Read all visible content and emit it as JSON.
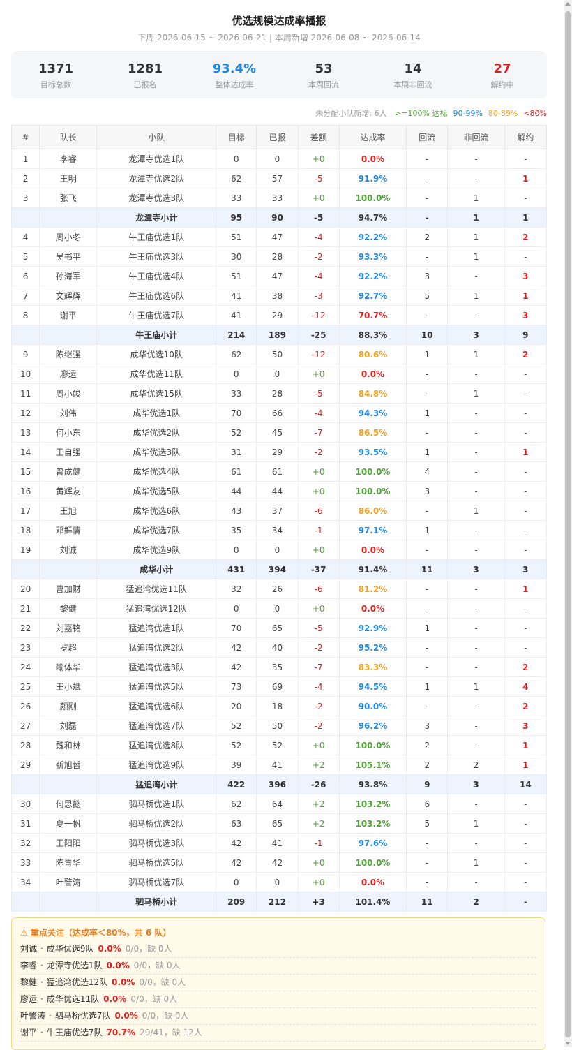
{
  "header": {
    "title": "优选规模达成率播报",
    "subtitle": "下周 2026-06-15 ~ 2026-06-21 | 本周新增 2026-06-08 ~ 2026-06-14"
  },
  "stats": [
    {
      "value": "1371",
      "label": "目标总数",
      "color": "#333333"
    },
    {
      "value": "1281",
      "label": "已报名",
      "color": "#333333"
    },
    {
      "value": "93.4%",
      "label": "整体达成率",
      "color": "#1e88e5"
    },
    {
      "value": "53",
      "label": "本周回流",
      "color": "#333333"
    },
    {
      "value": "14",
      "label": "本周非回流",
      "color": "#333333"
    },
    {
      "value": "27",
      "label": "解约中",
      "color": "#e02020"
    }
  ],
  "legend": {
    "unassigned": "未分配小队新增: 6人",
    "items": [
      {
        "text": ">=100% 达标",
        "color": "#52a33a"
      },
      {
        "text": "90-99%",
        "color": "#1e88e5"
      },
      {
        "text": "80-89%",
        "color": "#f0a020"
      },
      {
        "text": "<80%",
        "color": "#e02020"
      }
    ]
  },
  "table": {
    "columns": [
      "#",
      "队长",
      "小队",
      "目标",
      "已报",
      "差额",
      "达成率",
      "回流",
      "非回流",
      "解约"
    ],
    "rows": [
      {
        "type": "row",
        "idx": "1",
        "leader": "李睿",
        "team": "龙潭寺优选1队",
        "target": "0",
        "signed": "0",
        "diff": "+0",
        "rate": "0.0%",
        "back": "-",
        "nonback": "-",
        "jy": "-"
      },
      {
        "type": "row",
        "idx": "2",
        "leader": "王明",
        "team": "龙潭寺优选2队",
        "target": "62",
        "signed": "57",
        "diff": "-5",
        "rate": "91.9%",
        "back": "-",
        "nonback": "-",
        "jy": "1"
      },
      {
        "type": "row",
        "idx": "3",
        "leader": "张飞",
        "team": "龙潭寺优选3队",
        "target": "33",
        "signed": "33",
        "diff": "+0",
        "rate": "100.0%",
        "back": "-",
        "nonback": "1",
        "jy": "-"
      },
      {
        "type": "sub",
        "team": "龙潭寺小计",
        "target": "95",
        "signed": "90",
        "diff": "-5",
        "rate": "94.7%",
        "back": "-",
        "nonback": "1",
        "jy": "1"
      },
      {
        "type": "row",
        "idx": "4",
        "leader": "周小冬",
        "team": "牛王庙优选1队",
        "target": "51",
        "signed": "47",
        "diff": "-4",
        "rate": "92.2%",
        "back": "2",
        "nonback": "1",
        "jy": "2"
      },
      {
        "type": "row",
        "idx": "5",
        "leader": "吴书平",
        "team": "牛王庙优选3队",
        "target": "30",
        "signed": "28",
        "diff": "-2",
        "rate": "93.3%",
        "back": "-",
        "nonback": "1",
        "jy": "-"
      },
      {
        "type": "row",
        "idx": "6",
        "leader": "孙海军",
        "team": "牛王庙优选4队",
        "target": "51",
        "signed": "47",
        "diff": "-4",
        "rate": "92.2%",
        "back": "3",
        "nonback": "-",
        "jy": "3"
      },
      {
        "type": "row",
        "idx": "7",
        "leader": "文辉辉",
        "team": "牛王庙优选6队",
        "target": "41",
        "signed": "38",
        "diff": "-3",
        "rate": "92.7%",
        "back": "5",
        "nonback": "1",
        "jy": "1"
      },
      {
        "type": "row",
        "idx": "8",
        "leader": "谢平",
        "team": "牛王庙优选7队",
        "target": "41",
        "signed": "29",
        "diff": "-12",
        "rate": "70.7%",
        "back": "-",
        "nonback": "-",
        "jy": "3"
      },
      {
        "type": "sub",
        "team": "牛王庙小计",
        "target": "214",
        "signed": "189",
        "diff": "-25",
        "rate": "88.3%",
        "back": "10",
        "nonback": "3",
        "jy": "9"
      },
      {
        "type": "row",
        "idx": "9",
        "leader": "陈继强",
        "team": "成华优选10队",
        "target": "62",
        "signed": "50",
        "diff": "-12",
        "rate": "80.6%",
        "back": "1",
        "nonback": "1",
        "jy": "2"
      },
      {
        "type": "row",
        "idx": "10",
        "leader": "廖运",
        "team": "成华优选11队",
        "target": "0",
        "signed": "0",
        "diff": "+0",
        "rate": "0.0%",
        "back": "-",
        "nonback": "-",
        "jy": "-"
      },
      {
        "type": "row",
        "idx": "11",
        "leader": "周小竣",
        "team": "成华优选15队",
        "target": "33",
        "signed": "28",
        "diff": "-5",
        "rate": "84.8%",
        "back": "-",
        "nonback": "1",
        "jy": "-"
      },
      {
        "type": "row",
        "idx": "12",
        "leader": "刘伟",
        "team": "成华优选1队",
        "target": "70",
        "signed": "66",
        "diff": "-4",
        "rate": "94.3%",
        "back": "1",
        "nonback": "-",
        "jy": "-"
      },
      {
        "type": "row",
        "idx": "13",
        "leader": "何小东",
        "team": "成华优选2队",
        "target": "52",
        "signed": "45",
        "diff": "-7",
        "rate": "86.5%",
        "back": "-",
        "nonback": "-",
        "jy": "-"
      },
      {
        "type": "row",
        "idx": "14",
        "leader": "王自强",
        "team": "成华优选3队",
        "target": "31",
        "signed": "29",
        "diff": "-2",
        "rate": "93.5%",
        "back": "1",
        "nonback": "-",
        "jy": "1"
      },
      {
        "type": "row",
        "idx": "15",
        "leader": "曾成健",
        "team": "成华优选4队",
        "target": "61",
        "signed": "61",
        "diff": "+0",
        "rate": "100.0%",
        "back": "4",
        "nonback": "-",
        "jy": "-"
      },
      {
        "type": "row",
        "idx": "16",
        "leader": "黄辉友",
        "team": "成华优选5队",
        "target": "44",
        "signed": "44",
        "diff": "+0",
        "rate": "100.0%",
        "back": "3",
        "nonback": "-",
        "jy": "-"
      },
      {
        "type": "row",
        "idx": "17",
        "leader": "王旭",
        "team": "成华优选6队",
        "target": "43",
        "signed": "37",
        "diff": "-6",
        "rate": "86.0%",
        "back": "-",
        "nonback": "1",
        "jy": "-"
      },
      {
        "type": "row",
        "idx": "18",
        "leader": "邓鲜情",
        "team": "成华优选7队",
        "target": "35",
        "signed": "34",
        "diff": "-1",
        "rate": "97.1%",
        "back": "1",
        "nonback": "-",
        "jy": "-"
      },
      {
        "type": "row",
        "idx": "19",
        "leader": "刘诚",
        "team": "成华优选9队",
        "target": "0",
        "signed": "0",
        "diff": "+0",
        "rate": "0.0%",
        "back": "-",
        "nonback": "-",
        "jy": "-"
      },
      {
        "type": "sub",
        "team": "成华小计",
        "target": "431",
        "signed": "394",
        "diff": "-37",
        "rate": "91.4%",
        "back": "11",
        "nonback": "3",
        "jy": "3"
      },
      {
        "type": "row",
        "idx": "20",
        "leader": "曹加财",
        "team": "猛追湾优选11队",
        "target": "32",
        "signed": "26",
        "diff": "-6",
        "rate": "81.2%",
        "back": "-",
        "nonback": "-",
        "jy": "1"
      },
      {
        "type": "row",
        "idx": "21",
        "leader": "黎健",
        "team": "猛追湾优选12队",
        "target": "0",
        "signed": "0",
        "diff": "+0",
        "rate": "0.0%",
        "back": "-",
        "nonback": "-",
        "jy": "-"
      },
      {
        "type": "row",
        "idx": "22",
        "leader": "刘嘉铭",
        "team": "猛追湾优选1队",
        "target": "70",
        "signed": "65",
        "diff": "-5",
        "rate": "92.9%",
        "back": "1",
        "nonback": "-",
        "jy": "-"
      },
      {
        "type": "row",
        "idx": "23",
        "leader": "罗超",
        "team": "猛追湾优选2队",
        "target": "42",
        "signed": "40",
        "diff": "-2",
        "rate": "95.2%",
        "back": "-",
        "nonback": "-",
        "jy": "-"
      },
      {
        "type": "row",
        "idx": "24",
        "leader": "喻体华",
        "team": "猛追湾优选3队",
        "target": "42",
        "signed": "35",
        "diff": "-7",
        "rate": "83.3%",
        "back": "-",
        "nonback": "-",
        "jy": "2"
      },
      {
        "type": "row",
        "idx": "25",
        "leader": "王小斌",
        "team": "猛追湾优选5队",
        "target": "73",
        "signed": "69",
        "diff": "-4",
        "rate": "94.5%",
        "back": "1",
        "nonback": "1",
        "jy": "4"
      },
      {
        "type": "row",
        "idx": "26",
        "leader": "颜刚",
        "team": "猛追湾优选6队",
        "target": "20",
        "signed": "18",
        "diff": "-2",
        "rate": "90.0%",
        "back": "-",
        "nonback": "-",
        "jy": "2"
      },
      {
        "type": "row",
        "idx": "27",
        "leader": "刘磊",
        "team": "猛追湾优选7队",
        "target": "52",
        "signed": "50",
        "diff": "-2",
        "rate": "96.2%",
        "back": "3",
        "nonback": "-",
        "jy": "3"
      },
      {
        "type": "row",
        "idx": "28",
        "leader": "魏和林",
        "team": "猛追湾优选8队",
        "target": "52",
        "signed": "52",
        "diff": "+0",
        "rate": "100.0%",
        "back": "2",
        "nonback": "-",
        "jy": "1"
      },
      {
        "type": "row",
        "idx": "29",
        "leader": "靳旭哲",
        "team": "猛追湾优选9队",
        "target": "39",
        "signed": "41",
        "diff": "+2",
        "rate": "105.1%",
        "back": "2",
        "nonback": "2",
        "jy": "1"
      },
      {
        "type": "sub",
        "team": "猛追湾小计",
        "target": "422",
        "signed": "396",
        "diff": "-26",
        "rate": "93.8%",
        "back": "9",
        "nonback": "3",
        "jy": "14"
      },
      {
        "type": "row",
        "idx": "30",
        "leader": "何思懿",
        "team": "驷马桥优选1队",
        "target": "62",
        "signed": "64",
        "diff": "+2",
        "rate": "103.2%",
        "back": "6",
        "nonback": "-",
        "jy": "-"
      },
      {
        "type": "row",
        "idx": "31",
        "leader": "夏一帆",
        "team": "驷马桥优选2队",
        "target": "63",
        "signed": "65",
        "diff": "+2",
        "rate": "103.2%",
        "back": "5",
        "nonback": "1",
        "jy": "-"
      },
      {
        "type": "row",
        "idx": "32",
        "leader": "王阳阳",
        "team": "驷马桥优选3队",
        "target": "42",
        "signed": "41",
        "diff": "-1",
        "rate": "97.6%",
        "back": "-",
        "nonback": "-",
        "jy": "-"
      },
      {
        "type": "row",
        "idx": "33",
        "leader": "陈青华",
        "team": "驷马桥优选5队",
        "target": "42",
        "signed": "42",
        "diff": "+0",
        "rate": "100.0%",
        "back": "-",
        "nonback": "1",
        "jy": "-"
      },
      {
        "type": "row",
        "idx": "34",
        "leader": "叶警涛",
        "team": "驷马桥优选7队",
        "target": "0",
        "signed": "0",
        "diff": "+0",
        "rate": "0.0%",
        "back": "-",
        "nonback": "-",
        "jy": "-"
      },
      {
        "type": "sub",
        "team": "驷马桥小计",
        "target": "209",
        "signed": "212",
        "diff": "+3",
        "rate": "101.4%",
        "back": "11",
        "nonback": "2",
        "jy": "-"
      }
    ]
  },
  "focus": {
    "icon": "warning-icon",
    "title": "⚠ 重点关注（达成率＜80%，共 6 队）",
    "items": [
      {
        "leader": "刘诚",
        "team": "成华优选9队",
        "rate": "0.0%",
        "meta": "0/0，缺 0人"
      },
      {
        "leader": "李睿",
        "team": "龙潭寺优选1队",
        "rate": "0.0%",
        "meta": "0/0，缺 0人"
      },
      {
        "leader": "黎健",
        "team": "猛追湾优选12队",
        "rate": "0.0%",
        "meta": "0/0，缺 0人"
      },
      {
        "leader": "廖运",
        "team": "成华优选11队",
        "rate": "0.0%",
        "meta": "0/0，缺 0人"
      },
      {
        "leader": "叶警涛",
        "team": "驷马桥优选7队",
        "rate": "0.0%",
        "meta": "0/0，缺 0人"
      },
      {
        "leader": "谢平",
        "team": "牛王庙优选7队",
        "rate": "70.7%",
        "meta": "29/41，缺 12人"
      }
    ]
  }
}
